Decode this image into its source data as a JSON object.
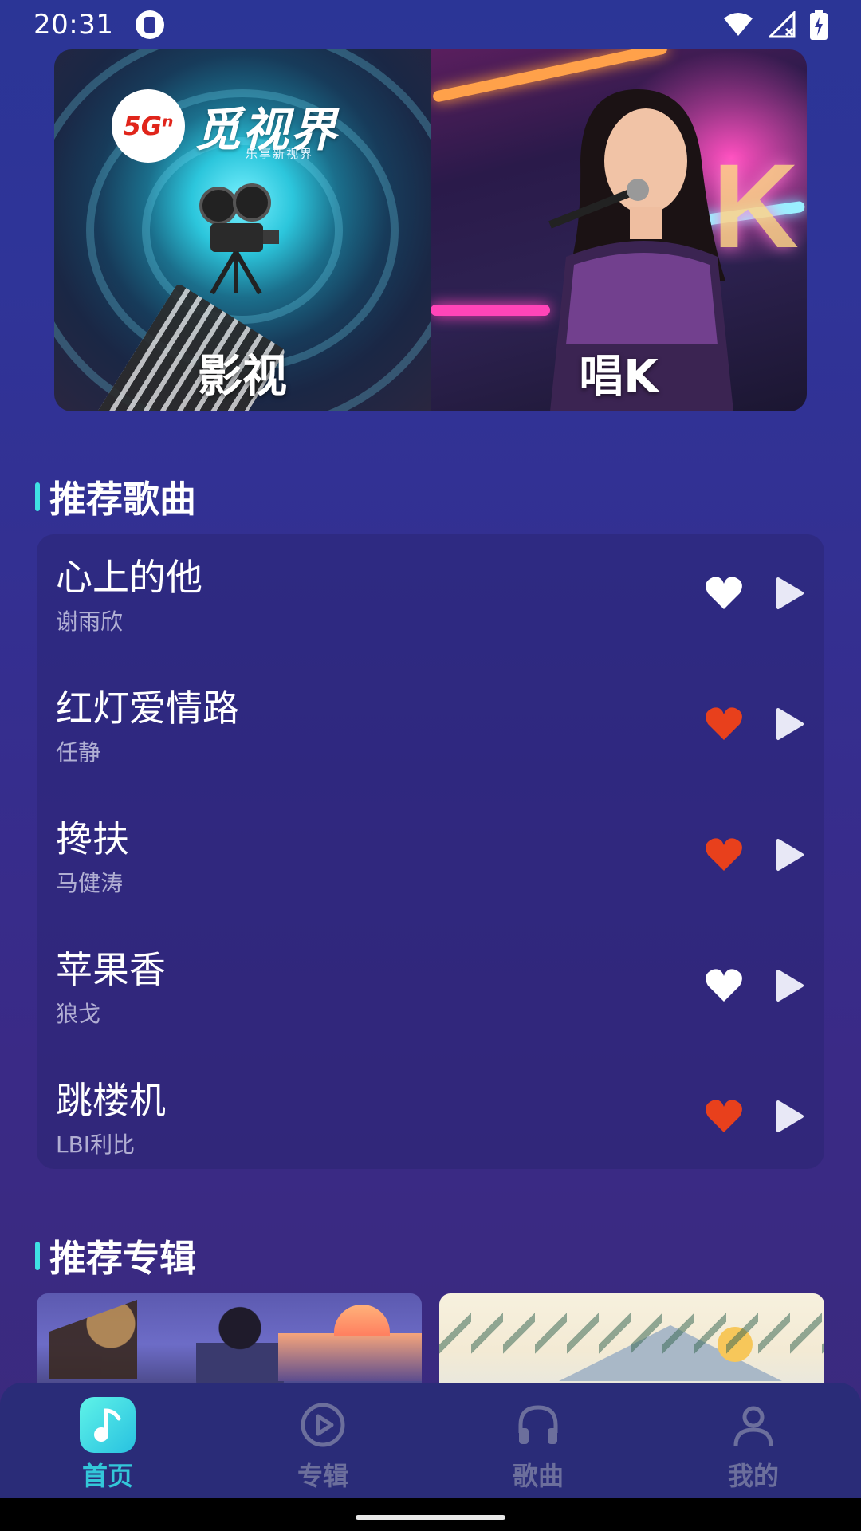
{
  "status_bar": {
    "time": "20:31"
  },
  "banners": [
    {
      "label": "影视",
      "logo_badge": "5Gⁿ",
      "logo_text": "觅视界",
      "logo_sub": "乐享新视界"
    },
    {
      "label": "唱K"
    }
  ],
  "recommended_songs": {
    "heading": "推荐歌曲",
    "items": [
      {
        "title": "心上的他",
        "artist": "谢雨欣",
        "favorite": false
      },
      {
        "title": "红灯爱情路",
        "artist": "任静",
        "favorite": true
      },
      {
        "title": "搀扶",
        "artist": "马健涛",
        "favorite": true
      },
      {
        "title": "苹果香",
        "artist": "狼戈",
        "favorite": false
      },
      {
        "title": "跳楼机",
        "artist": "LBI利比",
        "favorite": true
      }
    ]
  },
  "recommended_albums": {
    "heading": "推荐专辑"
  },
  "bottom_nav": {
    "items": [
      {
        "label": "首页",
        "icon": "music-note-icon",
        "active": true
      },
      {
        "label": "专辑",
        "icon": "play-circle-icon",
        "active": false
      },
      {
        "label": "歌曲",
        "icon": "headphones-icon",
        "active": false
      },
      {
        "label": "我的",
        "icon": "person-icon",
        "active": false
      }
    ]
  },
  "colors": {
    "accent": "#33c7d9",
    "heart_active": "#e8401c",
    "heart_inactive": "#ffffff",
    "section_bar": "#3fe0e4"
  }
}
